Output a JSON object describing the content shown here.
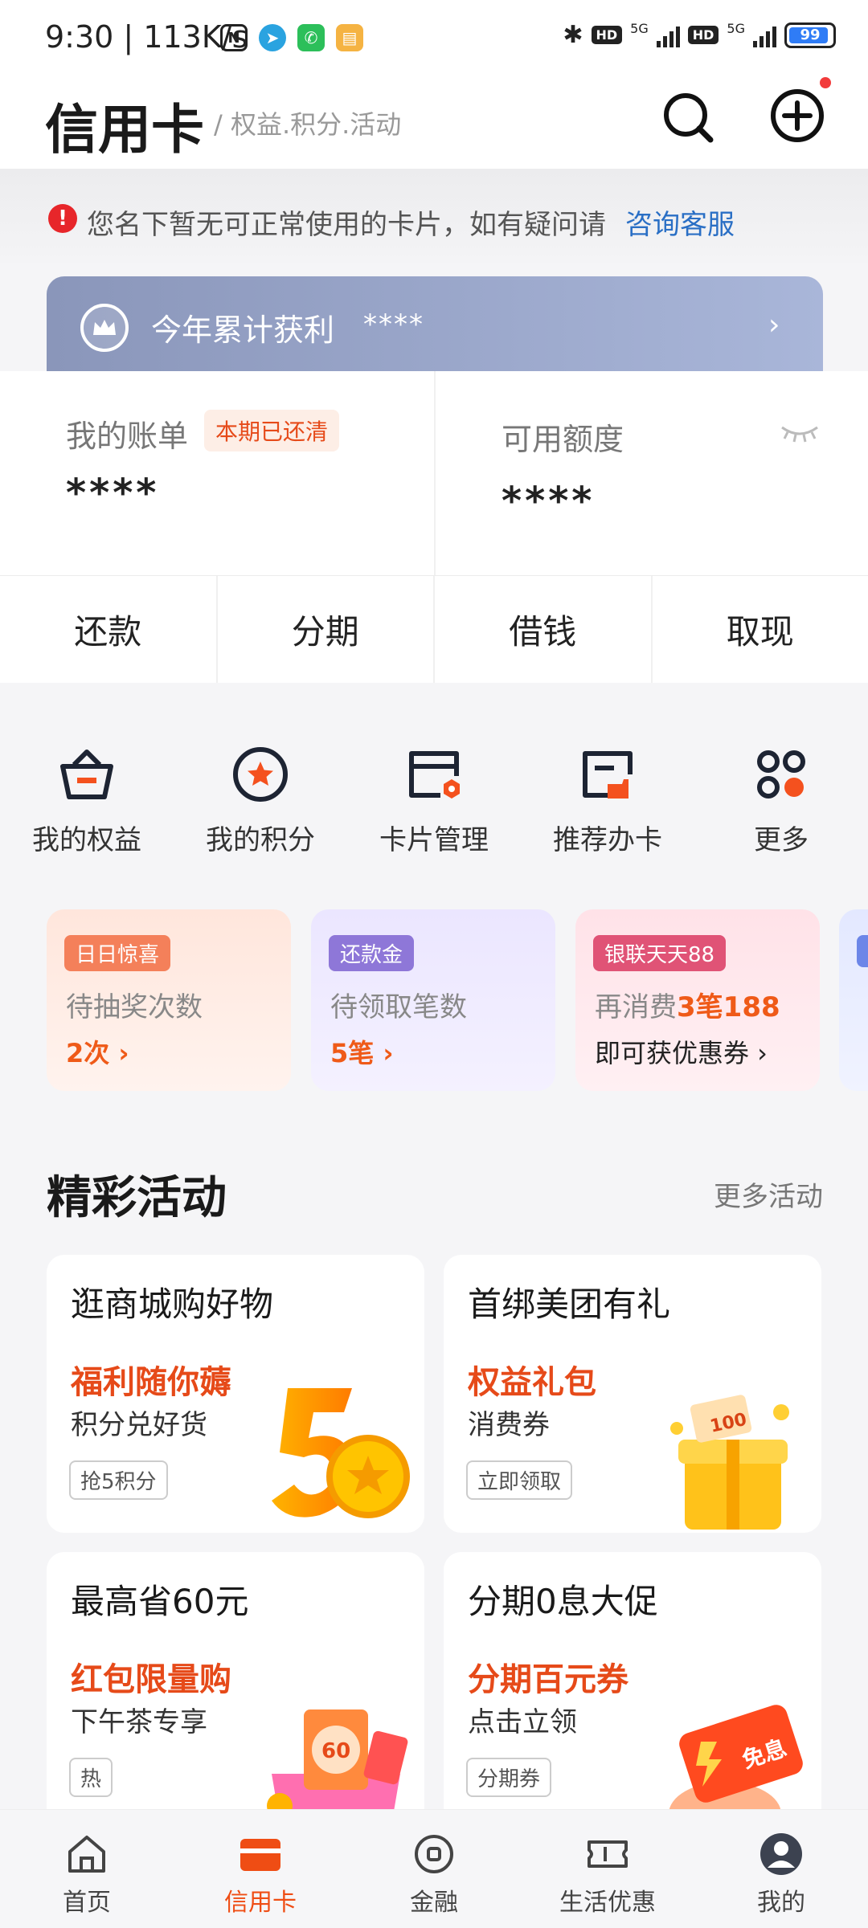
{
  "status_bar": {
    "time": "9:30",
    "speed": "113K/s",
    "net1": "5G",
    "net2": "5G",
    "hd": "HD",
    "battery": "99"
  },
  "header": {
    "title": "信用卡",
    "subtitle": "/ 权益.积分.活动"
  },
  "notice": {
    "text": "您名下暂无可正常使用的卡片，如有疑问请",
    "link": "咨询客服"
  },
  "profit": {
    "label": "今年累计获利",
    "value": "****"
  },
  "account": {
    "bill_label": "我的账单",
    "bill_badge": "本期已还清",
    "bill_value": "****",
    "limit_label": "可用额度",
    "limit_value": "****"
  },
  "actions": [
    "还款",
    "分期",
    "借钱",
    "取现"
  ],
  "menu": [
    {
      "label": "我的权益",
      "icon": "basket-icon"
    },
    {
      "label": "我的积分",
      "icon": "star-circle-icon"
    },
    {
      "label": "卡片管理",
      "icon": "card-manage-icon"
    },
    {
      "label": "推荐办卡",
      "icon": "card-recommend-icon"
    },
    {
      "label": "更多",
      "icon": "more-grid-icon"
    }
  ],
  "promos": [
    {
      "tag": "日日惊喜",
      "desc": "待抽奖次数",
      "value": "2次 ›"
    },
    {
      "tag": "还款金",
      "desc": "待领取笔数",
      "value": "5笔 ›"
    },
    {
      "tag": "银联天天88",
      "desc_prefix": "再消费",
      "desc_hl": "3笔188",
      "value": "即可获优惠券 ›"
    }
  ],
  "activities": {
    "title": "精彩活动",
    "more": "更多活动",
    "cards": [
      {
        "title": "逛商城购好物",
        "highlight": "福利随你薅",
        "sub": "积分兑好货",
        "tag": "抢5积分"
      },
      {
        "title": "首绑美团有礼",
        "highlight": "权益礼包",
        "sub": "消费券",
        "tag": "立即领取"
      },
      {
        "title": "最高省60元",
        "highlight": "红包限量购",
        "sub": "下午茶专享",
        "tag": "热"
      },
      {
        "title": "分期0息大促",
        "highlight": "分期百元券",
        "sub": "点击立领",
        "tag": "分期券"
      }
    ],
    "img_texts": {
      "gift": "100",
      "redpack": "60",
      "free": "免息"
    }
  },
  "nav": [
    {
      "label": "首页",
      "icon": "home-icon"
    },
    {
      "label": "信用卡",
      "icon": "credit-card-icon"
    },
    {
      "label": "金融",
      "icon": "finance-icon"
    },
    {
      "label": "生活优惠",
      "icon": "ticket-icon"
    },
    {
      "label": "我的",
      "icon": "profile-icon"
    }
  ],
  "colors": {
    "accent": "#ef4d14",
    "link": "#2a6fc5",
    "notice_red": "#e7262a"
  }
}
